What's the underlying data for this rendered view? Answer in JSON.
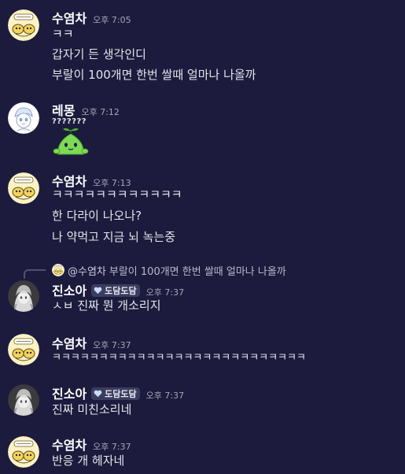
{
  "messages": [
    {
      "author": "수염차",
      "time": "오후 7:05",
      "lines": [
        "ㅋㅋ",
        "갑자기 든 생각인디",
        "부랄이 100개면 한번 쌀때 얼마나 나올까"
      ]
    },
    {
      "author": "레몽",
      "time": "오후 7:12",
      "lines": [
        "???????"
      ],
      "sticker": "green-sprout-creature-sticker"
    },
    {
      "author": "수염차",
      "time": "오후 7:13",
      "lines": [
        "ㅋㅋㅋㅋㅋㅋㅋㅋㅋㅋㅋㅋ",
        "한 다라이 나오나?",
        "나 약먹고 지금 뇌 녹는중"
      ]
    },
    {
      "reply": {
        "mention": "@수염차",
        "text": "부랄이 100개면 한번 쌀때 얼마나 나올까"
      },
      "author": "진소아",
      "badge": "도담도담",
      "time": "오후 7:37",
      "lines": [
        "ㅅㅂ 진짜 뭔 개소리지"
      ]
    },
    {
      "author": "수염차",
      "time": "오후 7:37",
      "lines": [
        "ㅋㅋㅋㅋㅋㅋㅋㅋㅋㅋㅋㅋㅋㅋㅋㅋㅋㅋㅋㅋㅋㅋㅋㅋㅋㅋㅋ"
      ]
    },
    {
      "author": "진소아",
      "badge": "도담도담",
      "time": "오후 7:37",
      "lines": [
        "진짜 미친소리네"
      ]
    },
    {
      "author": "수염차",
      "time": "오후 7:37",
      "lines": [
        "반응 개 헤자네"
      ]
    }
  ],
  "colors": {
    "background": "#1c1b3d",
    "username": "#ffffff",
    "timestamp": "#a3a6b8",
    "text": "#e3e4ea",
    "badge_bg": "#3b3d5e"
  },
  "icons": {
    "suyeomcha_avatar": "yellow-cartoon-avatar",
    "remong_avatar": "sketched-character-avatar",
    "jinsoa_avatar": "grayscale-anime-avatar",
    "badge_icon": "heart-icon"
  }
}
